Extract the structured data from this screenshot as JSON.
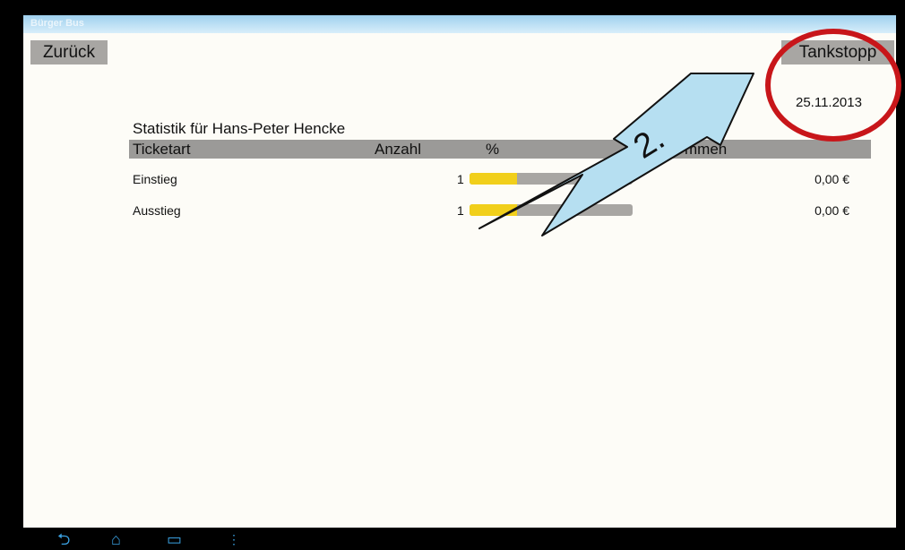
{
  "app": {
    "title": "Bürger Bus"
  },
  "buttons": {
    "back": "Zurück",
    "refuel": "Tankstopp"
  },
  "date": "25.11.2013",
  "statistics": {
    "title": "Statistik für Hans-Peter Hencke",
    "headers": {
      "ticket_type": "Ticketart",
      "count": "Anzahl",
      "percent": "%",
      "sum": "mmen"
    },
    "rows": [
      {
        "label": "Einstieg",
        "count": "1",
        "percent_fill": 0.29,
        "amount": "0,00 €"
      },
      {
        "label": "Ausstieg",
        "count": "1",
        "percent_fill": 0.29,
        "amount": "0,00 €"
      }
    ]
  },
  "annotation": {
    "step_label": "2.",
    "arrow_color": "#b6dff1",
    "circle_color": "#c8161a"
  },
  "colors": {
    "bar_fill": "#f1cf1b",
    "bar_track": "#a8a6a3",
    "nav_icons": "#3aa0e0"
  },
  "nav_icons": [
    "back-icon",
    "home-icon",
    "recent-apps-icon",
    "menu-icon"
  ]
}
